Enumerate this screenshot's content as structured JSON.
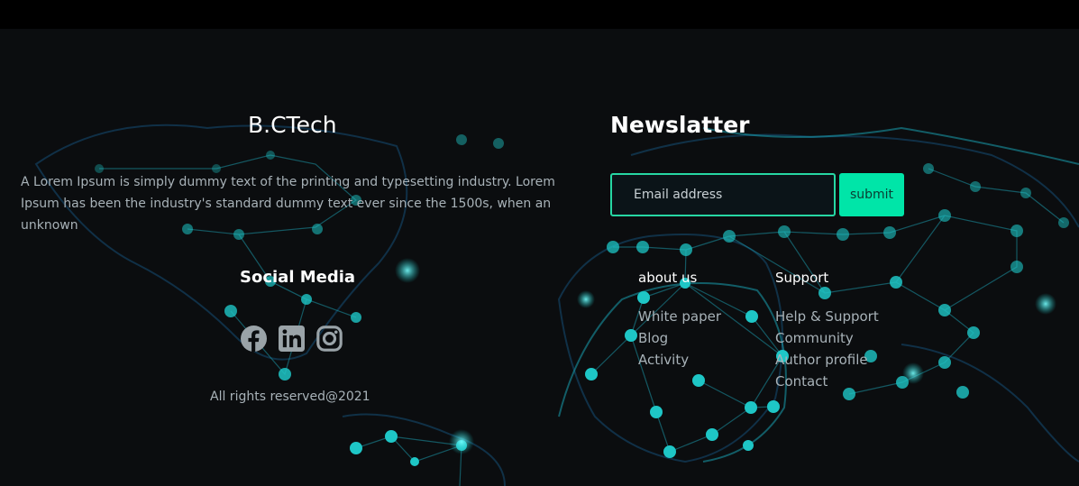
{
  "brand": {
    "title": "B.CTech",
    "description": "A Lorem Ipsum is simply dummy text of the printing and typesetting industry. Lorem Ipsum has been the industry's standard dummy text ever since the 1500s, when an unknown"
  },
  "social": {
    "title": "Social Media",
    "icons": [
      "facebook-icon",
      "linkedin-icon",
      "instagram-icon"
    ]
  },
  "copyright": "All rights reserved@2021",
  "newsletter": {
    "title": "Newslatter",
    "email_placeholder": "Email address",
    "submit_label": "submit"
  },
  "about_us": {
    "heading": "about us",
    "links": [
      "White paper",
      "Blog",
      "Activity"
    ]
  },
  "support": {
    "heading": "Support",
    "links": [
      "Help & Support",
      "Community",
      "Author profile",
      "Contact"
    ]
  },
  "colors": {
    "background": "#0b0d0f",
    "accent": "#00e5a8",
    "input_border": "#26d7a3",
    "muted_text": "#a8b2b8",
    "map_nodes": "#1ec6c6"
  }
}
